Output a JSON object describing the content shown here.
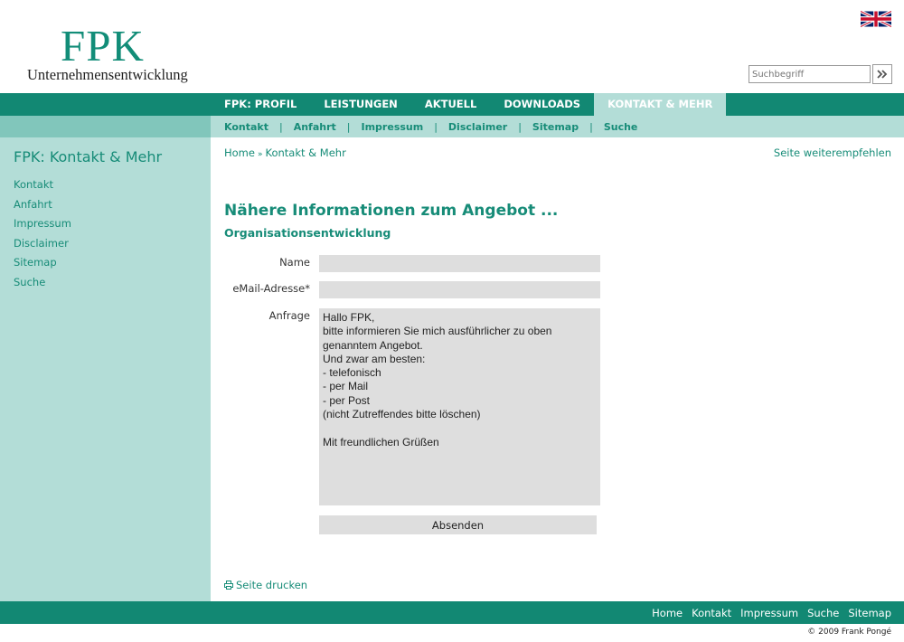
{
  "header": {
    "logo_title": "FPK",
    "logo_subtitle": "Unternehmensentwicklung",
    "language_icon": "uk-flag-icon",
    "search_placeholder": "Suchbegriff",
    "search_button_icon": "double-chevron-right-icon"
  },
  "main_nav": {
    "items": [
      "FPK: PROFIL",
      "LEISTUNGEN",
      "AKTUELL",
      "DOWNLOADS",
      "KONTAKT & MEHR"
    ],
    "active_index": 4
  },
  "sub_nav": {
    "items": [
      "Kontakt",
      "Anfahrt",
      "Impressum",
      "Disclaimer",
      "Sitemap",
      "Suche"
    ],
    "separator": "|"
  },
  "sidebar": {
    "title": "FPK: Kontakt & Mehr",
    "items": [
      "Kontakt",
      "Anfahrt",
      "Impressum",
      "Disclaimer",
      "Sitemap",
      "Suche"
    ]
  },
  "breadcrumb": {
    "home": "Home",
    "separator": "»",
    "current": "Kontakt & Mehr"
  },
  "recommend_link": "Seite weiterempfehlen",
  "content": {
    "title": "Nähere Informationen zum Angebot ...",
    "subtitle": "Organisationsentwicklung"
  },
  "form": {
    "name_label": "Name",
    "name_value": "",
    "email_label": "eMail-Adresse*",
    "email_value": "",
    "request_label": "Anfrage",
    "request_value": "Hallo FPK,\nbitte informieren Sie mich ausführlicher zu oben genanntem Angebot.\nUnd zwar am besten:\n- telefonisch\n- per Mail\n- per Post\n(nicht Zutreffendes bitte löschen)\n\nMit freundlichen Grüßen",
    "submit_label": "Absenden"
  },
  "print_link": "Seite drucken",
  "footer": {
    "links": [
      "Home",
      "Kontakt",
      "Impressum",
      "Suche",
      "Sitemap"
    ],
    "copyright": "© 2009  Frank Pongé"
  },
  "colors": {
    "brand_green": "#128873",
    "text_green": "#178c78",
    "light_teal": "#b3ddd7",
    "medium_teal": "#81c6bb",
    "field_gray": "#dedede"
  }
}
